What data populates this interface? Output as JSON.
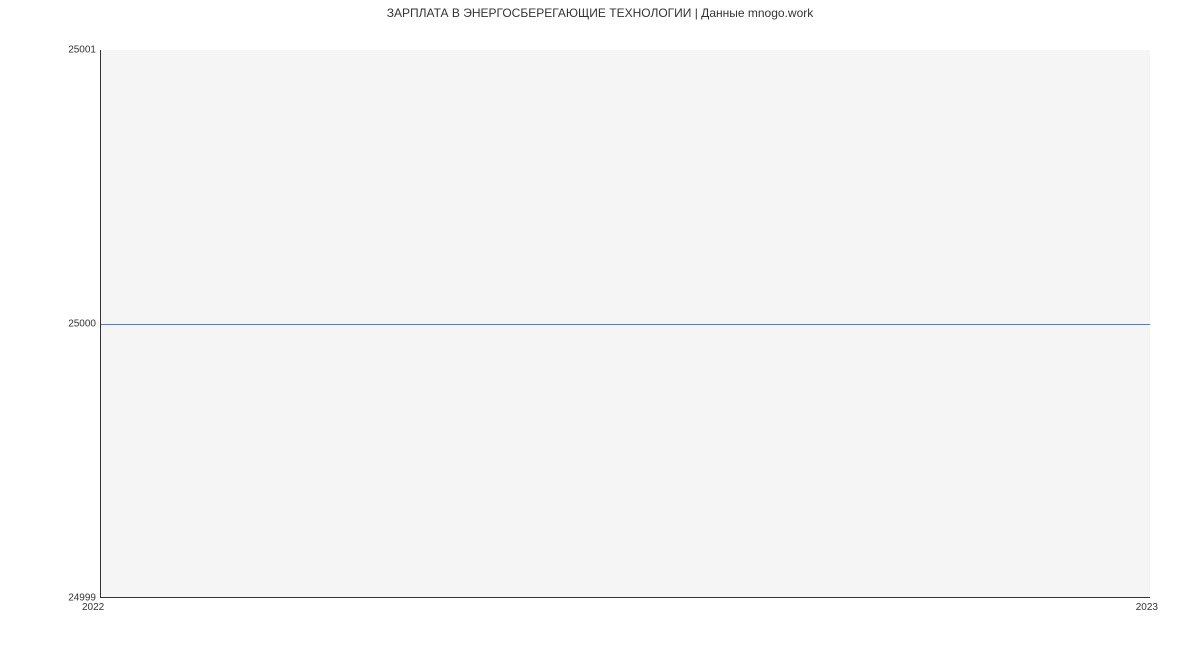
{
  "chart_data": {
    "type": "line",
    "title": "ЗАРПЛАТА В  ЭНЕРГОСБЕРЕГАЮЩИЕ ТЕХНОЛОГИИ | Данные mnogo.work",
    "xlabel": "",
    "ylabel": "",
    "x": [
      2022,
      2023
    ],
    "values": [
      25000,
      25000
    ],
    "x_ticks": [
      "2022",
      "2023"
    ],
    "y_ticks": [
      "24999",
      "25000",
      "25001"
    ],
    "xlim": [
      2022,
      2023
    ],
    "ylim": [
      24999,
      25001
    ]
  }
}
